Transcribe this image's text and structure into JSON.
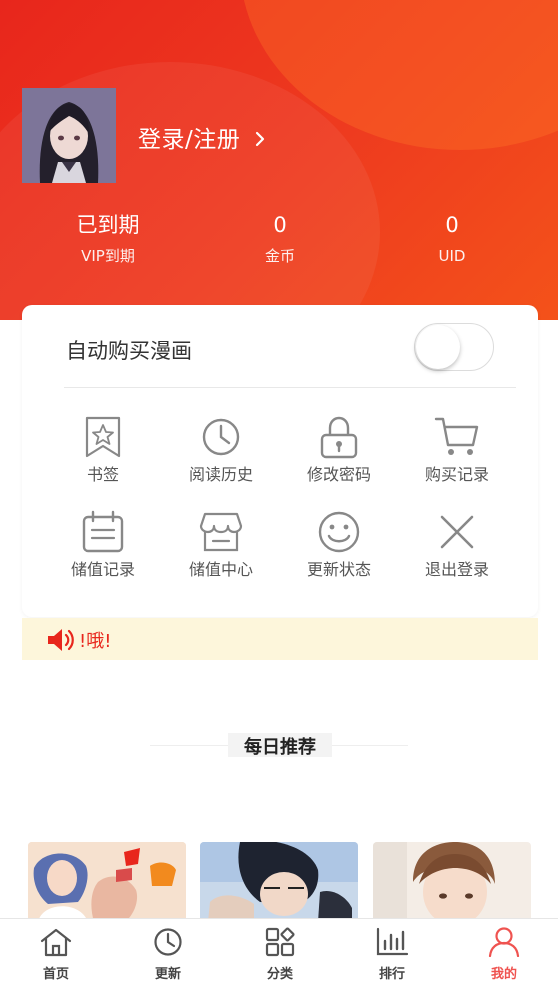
{
  "header": {
    "login_label": "登录/注册",
    "chevron": "chevron-right-icon",
    "stats": [
      {
        "value": "已到期",
        "label": "VIP到期"
      },
      {
        "value": "0",
        "label": "金币"
      },
      {
        "value": "0",
        "label": "UID"
      }
    ]
  },
  "card": {
    "auto_buy_label": "自动购买漫画",
    "auto_buy_on": false,
    "grid": [
      {
        "icon": "bookmark-icon",
        "label": "书签"
      },
      {
        "icon": "clock-icon",
        "label": "阅读历史"
      },
      {
        "icon": "lock-icon",
        "label": "修改密码"
      },
      {
        "icon": "cart-icon",
        "label": "购买记录"
      },
      {
        "icon": "calendar-icon",
        "label": "储值记录"
      },
      {
        "icon": "store-icon",
        "label": "储值中心"
      },
      {
        "icon": "smiley-icon",
        "label": "更新状态"
      },
      {
        "icon": "close-icon",
        "label": "退出登录"
      }
    ]
  },
  "notice": {
    "icon": "speaker-icon",
    "text": "!哦!"
  },
  "daily": {
    "title": "每日推荐"
  },
  "tabbar": {
    "tabs": [
      {
        "icon": "home-icon",
        "label": "首页"
      },
      {
        "icon": "clock-icon",
        "label": "更新"
      },
      {
        "icon": "category-icon",
        "label": "分类"
      },
      {
        "icon": "ranking-icon",
        "label": "排行"
      },
      {
        "icon": "profile-icon",
        "label": "我的"
      }
    ],
    "active_index": 4
  },
  "colors": {
    "brand_red": "#e8261c",
    "accent_orange": "#f4521a",
    "icon_gray": "#888888",
    "active_tab": "#ef5350",
    "notice_bg": "#fdf6db"
  }
}
